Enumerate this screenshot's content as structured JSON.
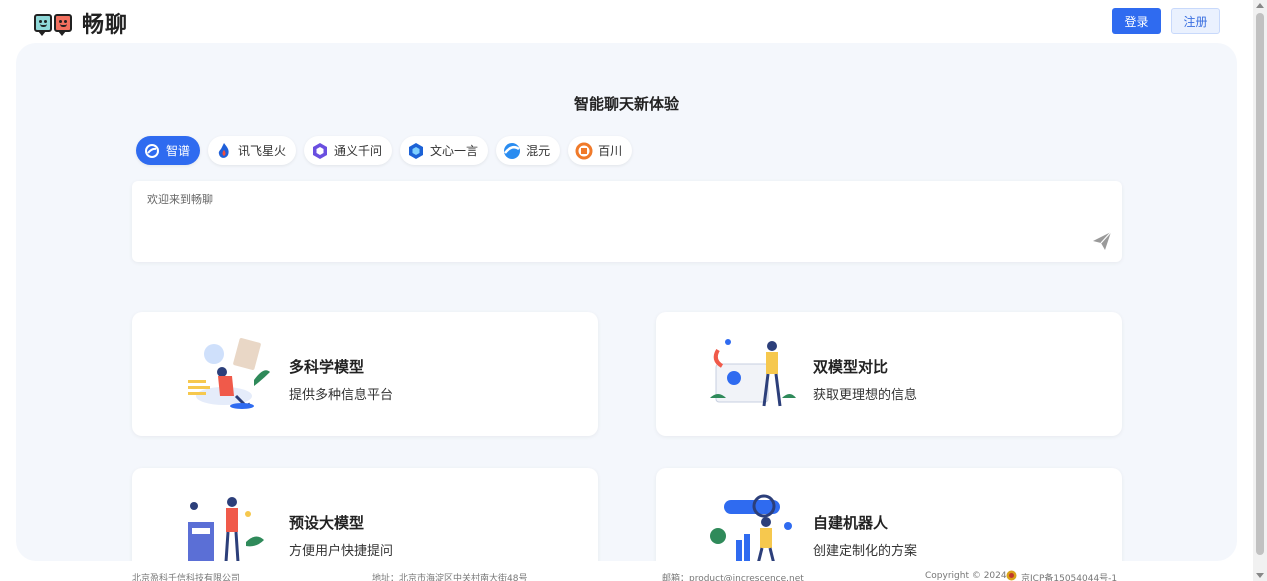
{
  "header": {
    "app_name": "畅聊",
    "login_label": "登录",
    "register_label": "注册"
  },
  "main": {
    "headline": "智能聊天新体验",
    "models": [
      {
        "label": "智谱",
        "icon": "zhipu-icon",
        "active": true
      },
      {
        "label": "讯飞星火",
        "icon": "spark-icon",
        "active": false
      },
      {
        "label": "通义千问",
        "icon": "tongyi-icon",
        "active": false
      },
      {
        "label": "文心一言",
        "icon": "wenxin-icon",
        "active": false
      },
      {
        "label": "混元",
        "icon": "hunyuan-icon",
        "active": false
      },
      {
        "label": "百川",
        "icon": "baichuan-icon",
        "active": false
      }
    ],
    "chat_placeholder": "欢迎来到畅聊",
    "cards": [
      {
        "title": "多科学模型",
        "desc": "提供多种信息平台"
      },
      {
        "title": "双模型对比",
        "desc": "获取更理想的信息"
      },
      {
        "title": "预设大模型",
        "desc": "方便用户快捷提问"
      },
      {
        "title": "自建机器人",
        "desc": "创建定制化的方案"
      }
    ]
  },
  "footer": {
    "company": "北京盈科千信科技有限公司",
    "address": "地址：北京市海淀区中关村南大街48号",
    "email": "邮箱：product@increscence.net",
    "copyright": "Copyright © 2024",
    "icp": "京ICP备15054044号-1"
  },
  "colors": {
    "accent": "#2f6bf0",
    "panel_bg": "#f4f7fc"
  }
}
